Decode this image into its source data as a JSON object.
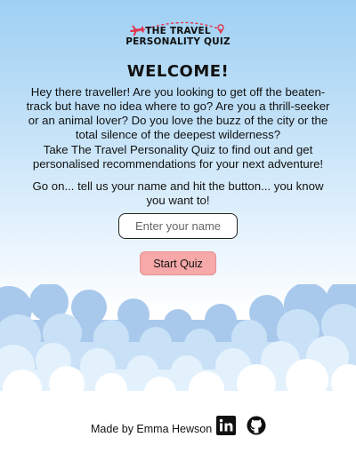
{
  "logo": {
    "line1": "THE TRAVEL",
    "line2": "PERSONALITY QUIZ",
    "icons": [
      "airplane-icon",
      "location-pin-icon"
    ]
  },
  "welcome": {
    "heading": "WELCOME!",
    "para1": "Hey there traveller! Are you looking to get off the beaten-track but have no idea where to go? Are you a thrill-seeker or an animal lover? Do you love the buzz of the city or the total silence of the deepest wilderness?",
    "para2": "Take The Travel Personality Quiz to find out and get personalised recommendations for your next adventure!",
    "para3": "Go on... tell us your name and hit the button... you know you want to!"
  },
  "form": {
    "name_placeholder": "Enter your name",
    "name_value": "",
    "start_label": "Start Quiz"
  },
  "footer": {
    "credit": "Made by Emma Hewson",
    "icons": [
      "linkedin-icon",
      "github-icon"
    ]
  },
  "colors": {
    "sky_top": "#9fd0f3",
    "cloud_back": "#a9c9ec",
    "cloud_mid": "#dceefc",
    "button_bg": "#f7a8a8",
    "plane": "#e2364e"
  }
}
